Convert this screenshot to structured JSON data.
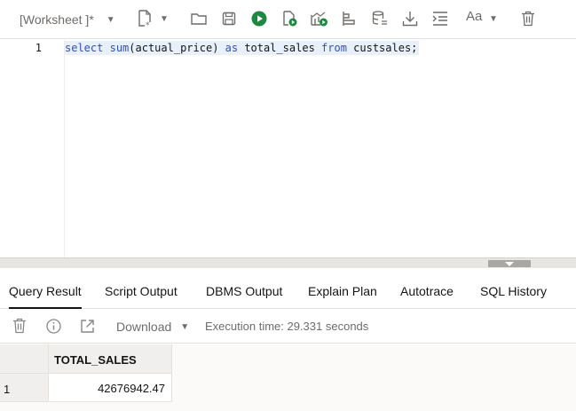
{
  "toolbar": {
    "worksheet_label": "[Worksheet ]*",
    "font_label": "Aa",
    "icons": [
      "new-file-icon",
      "open-folder-icon",
      "save-icon",
      "run-statement-icon",
      "run-script-icon",
      "explain-plan-icon",
      "autotrace-icon",
      "database-icon",
      "download-icon",
      "format-icon",
      "font-icon",
      "delete-icon"
    ],
    "run_color": "#1b8a3f"
  },
  "editor": {
    "line_number": "1",
    "tokens": [
      {
        "text": "select",
        "kw": true
      },
      {
        "text": " ",
        "kw": false
      },
      {
        "text": "sum",
        "kw": true
      },
      {
        "text": "(actual_price) ",
        "kw": false
      },
      {
        "text": "as",
        "kw": true
      },
      {
        "text": " total_sales ",
        "kw": false
      },
      {
        "text": "from",
        "kw": true
      },
      {
        "text": " custsales;",
        "kw": false
      }
    ]
  },
  "tabs": [
    {
      "label": "Query Result",
      "active": true
    },
    {
      "label": "Script Output",
      "active": false
    },
    {
      "label": "DBMS Output",
      "active": false
    },
    {
      "label": "Explain Plan",
      "active": false
    },
    {
      "label": "Autotrace",
      "active": false
    },
    {
      "label": "SQL History",
      "active": false
    }
  ],
  "result_toolbar": {
    "download_label": "Download",
    "execution_time": "Execution time: 29.331 seconds"
  },
  "grid": {
    "columns": [
      "TOTAL_SALES"
    ],
    "rows": [
      {
        "num": "1",
        "values": [
          "42676942.47"
        ]
      }
    ]
  }
}
